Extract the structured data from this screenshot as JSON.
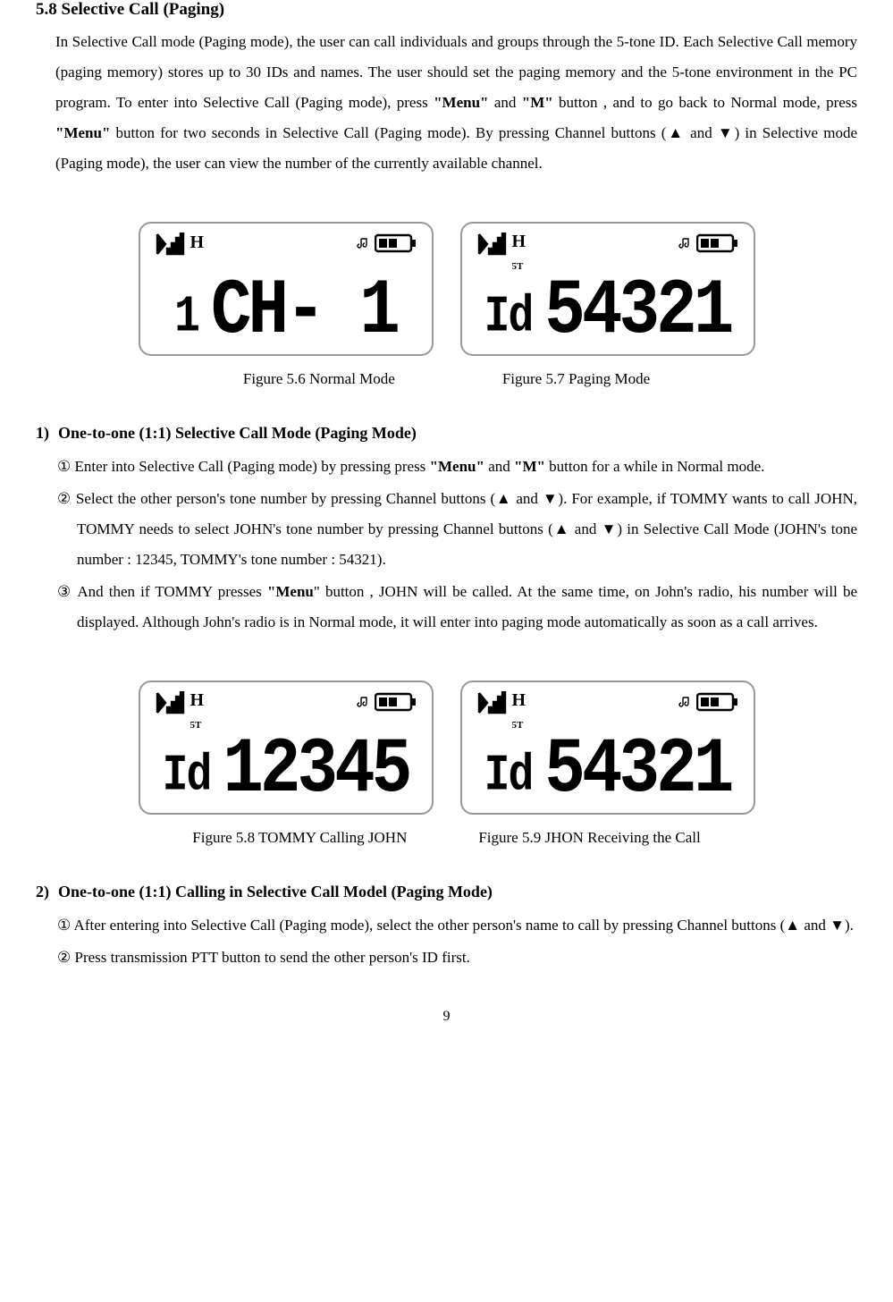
{
  "heading_58": "5.8 Selective Call (Paging)",
  "intro": {
    "t1": "In Selective Call mode (Paging mode), the user can call individuals and groups through the 5-tone ID. Each Selective Call memory (paging memory) stores up to 30 IDs and names. The user should set the paging memory and the 5-tone environment in the PC program. To enter into Selective Call (Paging mode), press ",
    "menu1": "\"Menu\"",
    "t2": " and ",
    "m1": "\"M\"",
    "t3": " button , and to go back to Normal mode, press ",
    "menu2": "\"Menu\"",
    "t4": " button for two seconds in Selective Call (Paging mode). By pressing Channel buttons (▲ and ▼) in Selective mode (Paging mode), the user can view the number of the currently available channel."
  },
  "lcd1": {
    "h": "H",
    "small_num": "1",
    "main": "CH-   1"
  },
  "lcd2": {
    "h": "H",
    "ft": "5T",
    "small": "Id",
    "main": "54321"
  },
  "cap56": "Figure 5.6 Normal Mode",
  "cap57": "Figure 5.7 Paging Mode",
  "sub1_num": "1)",
  "sub1_title": "One-to-one (1:1) Selective Call Mode (Paging Mode)",
  "step1_1a": "① Enter into Selective Call (Paging mode) by pressing press ",
  "step1_1_menu": "\"Menu\"",
  "step1_1b": " and  ",
  "step1_1_m": "\"M\"",
  "step1_1c": " button for a while in Normal mode.",
  "step1_2": "② Select the other  person's tone number by pressing Channel buttons (▲ and ▼).  For example, if TOMMY wants to call  JOHN, TOMMY needs to select JOHN's tone number by pressing Channel buttons (▲ and ▼) in Selective Call Mode (JOHN's tone number : 12345, TOMMY's tone number : 54321).",
  "step1_3a": "③ And then if TOMMY presses ",
  "step1_3_menu": "\"Menu",
  "step1_3b": "\" button , JOHN will be called.  At the same time, on John's radio, his number will be displayed.  Although John's radio is in Normal mode, it will enter into paging mode automatically as soon as a call arrives.",
  "lcd3": {
    "h": "H",
    "ft": "5T",
    "small": "Id",
    "main": "12345"
  },
  "lcd4": {
    "h": "H",
    "ft": "5T",
    "small": "Id",
    "main": "54321"
  },
  "cap58": "Figure 5.8 TOMMY Calling JOHN",
  "cap59": "Figure 5.9 JHON Receiving the Call",
  "sub2_num": "2)",
  "sub2_title": "One-to-one (1:1) Calling in Selective Call Model (Paging Mode)",
  "step2_1": "① After entering into Selective Call (Paging mode), select the other person's name to call by pressing Channel buttons (▲ and ▼).",
  "step2_2": "② Press transmission PTT button to send the other person's ID first.",
  "pagenum": "9"
}
